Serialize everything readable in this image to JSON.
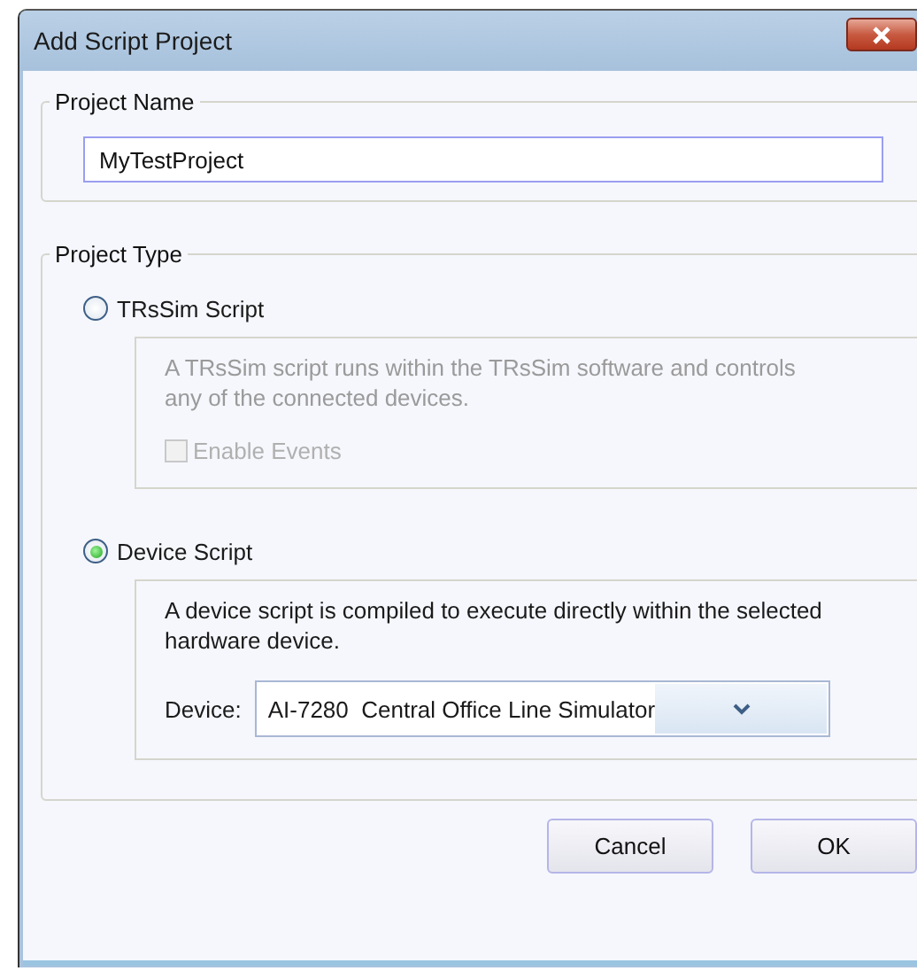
{
  "window": {
    "title": "Add Script Project"
  },
  "project_name": {
    "label": "Project Name",
    "value": "MyTestProject"
  },
  "project_type": {
    "label": "Project Type",
    "options": [
      {
        "kind": "script",
        "label": "TRsSim Script",
        "selected": false,
        "description": "A TRsSim script runs within the TRsSim software and controls any of the connected devices.",
        "enable_events": {
          "label": "Enable Events",
          "checked": false,
          "disabled": true
        }
      },
      {
        "kind": "device",
        "label": "Device Script",
        "selected": true,
        "description": "A device script is compiled to execute directly within the selected hardware device.",
        "device": {
          "label": "Device:",
          "value": "AI-7280  Central Office Line Simulator"
        }
      }
    ]
  },
  "buttons": [
    {
      "label": "Cancel"
    },
    {
      "label": "OK"
    }
  ]
}
